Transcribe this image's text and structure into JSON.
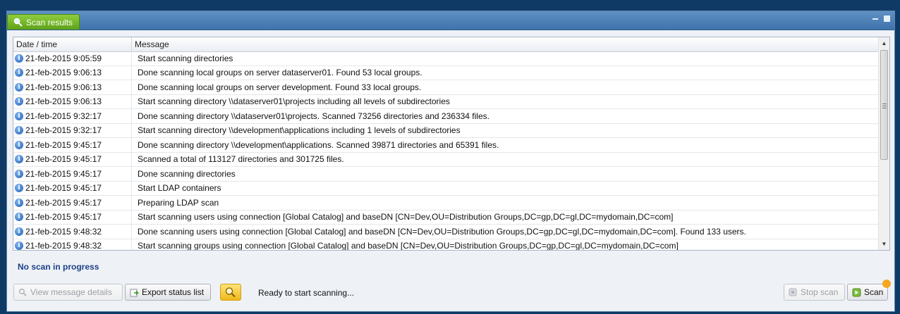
{
  "panel": {
    "tab_label": "Scan results"
  },
  "grid": {
    "columns": [
      "Date / time",
      "Message"
    ],
    "rows": [
      {
        "date": "21-feb-2015 9:05:59",
        "message": "Start scanning directories"
      },
      {
        "date": "21-feb-2015 9:06:13",
        "message": "Done scanning local groups on server dataserver01. Found 53 local groups."
      },
      {
        "date": "21-feb-2015 9:06:13",
        "message": "Done scanning local groups on server development. Found 33 local groups."
      },
      {
        "date": "21-feb-2015 9:06:13",
        "message": "Start scanning directory \\\\dataserver01\\projects including all levels of subdirectories"
      },
      {
        "date": "21-feb-2015 9:32:17",
        "message": "Done scanning directory \\\\dataserver01\\projects. Scanned 73256 directories and 236334 files."
      },
      {
        "date": "21-feb-2015 9:32:17",
        "message": "Start scanning directory \\\\development\\applications including 1 levels of subdirectories"
      },
      {
        "date": "21-feb-2015 9:45:17",
        "message": "Done scanning directory \\\\development\\applications. Scanned 39871 directories and 65391 files."
      },
      {
        "date": "21-feb-2015 9:45:17",
        "message": "Scanned a total of 113127 directories and 301725 files."
      },
      {
        "date": "21-feb-2015 9:45:17",
        "message": "Done scanning directories"
      },
      {
        "date": "21-feb-2015 9:45:17",
        "message": "Start LDAP containers"
      },
      {
        "date": "21-feb-2015 9:45:17",
        "message": "Preparing LDAP scan"
      },
      {
        "date": "21-feb-2015 9:45:17",
        "message": "Start scanning users using connection [Global Catalog] and baseDN [CN=Dev,OU=Distribution Groups,DC=gp,DC=gl,DC=mydomain,DC=com]"
      },
      {
        "date": "21-feb-2015 9:48:32",
        "message": "Done scanning users using connection [Global Catalog] and baseDN [CN=Dev,OU=Distribution Groups,DC=gp,DC=gl,DC=mydomain,DC=com]. Found 133 users."
      },
      {
        "date": "21-feb-2015 9:48:32",
        "message": "Start scanning groups using connection [Global Catalog] and baseDN [CN=Dev,OU=Distribution Groups,DC=gp,DC=gl,DC=mydomain,DC=com]"
      }
    ]
  },
  "status": {
    "scan_state": "No scan in progress",
    "ready_text": "Ready to start scanning..."
  },
  "buttons": {
    "view_details": "View message details",
    "export": "Export status list",
    "stop": "Stop scan",
    "scan": "Scan"
  },
  "colors": {
    "tab_green": "#6db32a",
    "title_blue": "#4a7fb5",
    "status_text": "#1d3f86"
  }
}
